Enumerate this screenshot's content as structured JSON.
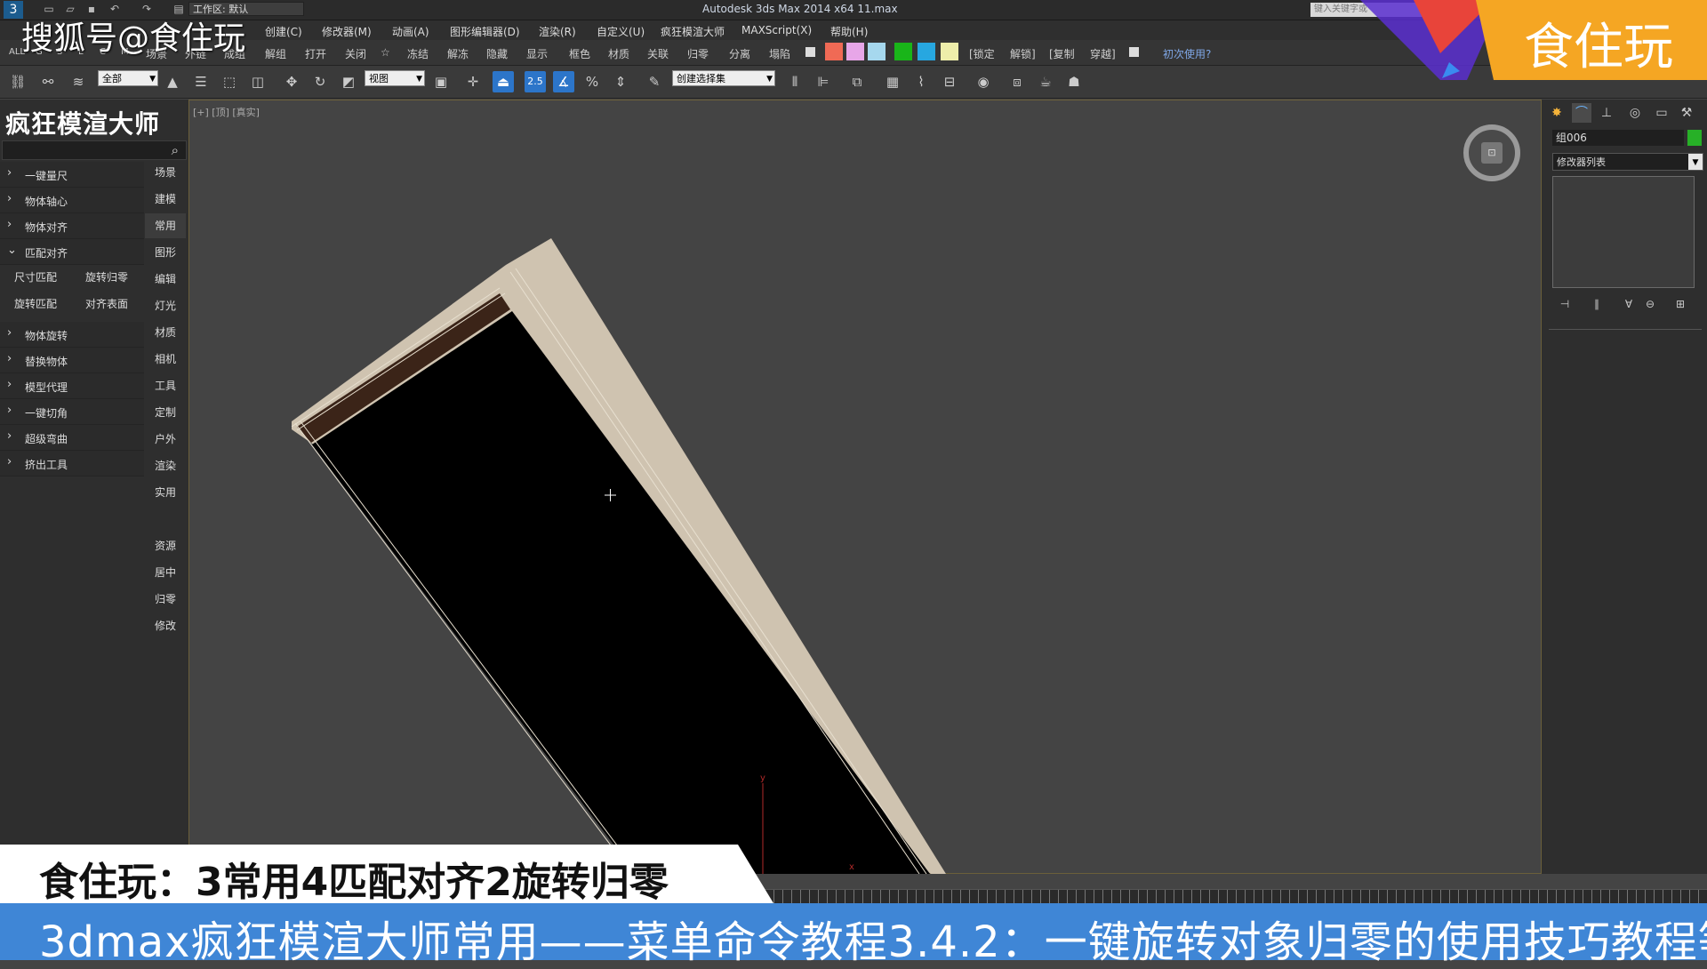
{
  "app": {
    "title": "Autodesk 3ds Max  2014 x64    11.max",
    "workspace": "工作区: 默认",
    "search_placeholder": "键入关键字或"
  },
  "menubar": [
    "创建(C)",
    "修改器(M)",
    "动画(A)",
    "图形编辑器(D)",
    "渲染(R)",
    "自定义(U)",
    "疯狂模渲大师",
    "MAXScript(X)",
    "帮助(H)"
  ],
  "toolbar1": {
    "left_tabs": [
      "ALL",
      "G",
      "S",
      "L",
      "C",
      "M"
    ],
    "items": [
      "场景",
      "外链",
      "成组",
      "解组",
      "打开",
      "关闭",
      "☆",
      "冻结",
      "解冻",
      "隐藏",
      "显示",
      "框色",
      "材质",
      "关联",
      "归零",
      "分离",
      "塌陷"
    ],
    "bracket_items": [
      "[锁定",
      "解锁]",
      "[复制",
      "穿越]"
    ],
    "first_use": "初次使用?",
    "swatch_colors": [
      "#f06a55",
      "#e7a6e8",
      "#a6d8ee",
      "#19b519",
      "#27a7e0",
      "#eeeeaa"
    ]
  },
  "toolbar2": {
    "filter_value": "全部",
    "refcoord_value": "视图",
    "selset_value": "创建选择集",
    "snap_label": "2.5"
  },
  "leftpanel": {
    "title": "疯狂模渲大师",
    "items": [
      {
        "label": "一键量尺",
        "expanded": false
      },
      {
        "label": "物体轴心",
        "expanded": false
      },
      {
        "label": "物体对齐",
        "expanded": false
      },
      {
        "label": "匹配对齐",
        "expanded": true
      },
      {
        "label": "物体旋转",
        "expanded": false
      },
      {
        "label": "替换物体",
        "expanded": false
      },
      {
        "label": "模型代理",
        "expanded": false
      },
      {
        "label": "一键切角",
        "expanded": false
      },
      {
        "label": "超级弯曲",
        "expanded": false
      },
      {
        "label": "挤出工具",
        "expanded": false
      }
    ],
    "sub_buttons": [
      "尺寸匹配",
      "旋转归零",
      "旋转匹配",
      "对齐表面"
    ],
    "categories": [
      "场景",
      "建模",
      "常用",
      "图形",
      "编辑",
      "灯光",
      "材质",
      "相机",
      "工具",
      "定制",
      "户外",
      "渲染",
      "实用"
    ],
    "categories2": [
      "资源",
      "居中",
      "归零",
      "修改"
    ],
    "selected_category": "常用"
  },
  "viewport": {
    "label": "[+] [顶] [真实]",
    "axis_y": "y",
    "axis_x": "x"
  },
  "rightpanel": {
    "object_name": "组006",
    "object_color": "#27b027",
    "modifier_list": "修改器列表"
  },
  "captions": {
    "line1": "食住玩：3常用4匹配对齐2旋转归零",
    "line2": "3dmax疯狂模渲大师常用——菜单命令教程3.4.2：一键旋转对象归零的使用技巧教程等"
  },
  "watermarks": {
    "left": "搜狐号@食住玩",
    "right": "食住玩"
  }
}
